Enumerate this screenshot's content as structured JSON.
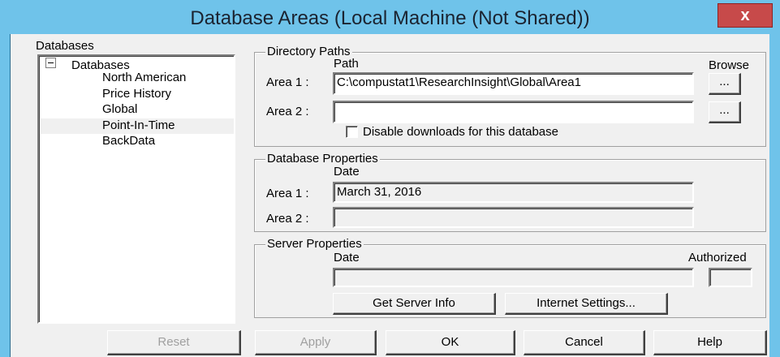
{
  "window": {
    "title": "Database Areas  (Local Machine (Not Shared))",
    "close_glyph": "x"
  },
  "databases_panel": {
    "label": "Databases",
    "root": "Databases",
    "items": [
      "North American",
      "Price History",
      "Global",
      "Point-In-Time",
      "BackData"
    ],
    "selected": "Global"
  },
  "directory_paths": {
    "label": "Directory Paths",
    "path_header": "Path",
    "browse_header": "Browse",
    "area1_label": "Area 1 :",
    "area1_value": "C:\\compustat1\\ResearchInsight\\Global\\Area1",
    "area2_label": "Area 2 :",
    "area2_value": "",
    "browse_label": "...",
    "disable_downloads_label": "Disable downloads for this database",
    "disable_downloads_checked": false
  },
  "database_properties": {
    "label": "Database Properties",
    "date_header": "Date",
    "area1_label": "Area 1 :",
    "area1_value": "March 31, 2016",
    "area2_label": "Area 2 :",
    "area2_value": ""
  },
  "server_properties": {
    "label": "Server Properties",
    "date_header": "Date",
    "authorized_header": "Authorized",
    "date_value": "",
    "authorized_value": "",
    "get_server_info": "Get Server Info",
    "internet_settings": "Internet Settings..."
  },
  "buttons": {
    "reset": "Reset",
    "apply": "Apply",
    "ok": "OK",
    "cancel": "Cancel",
    "help": "Help"
  },
  "colors": {
    "title_bar": "#6fc3ea",
    "close_button": "#c74a4a",
    "dialog_face": "#f0f0f0"
  }
}
